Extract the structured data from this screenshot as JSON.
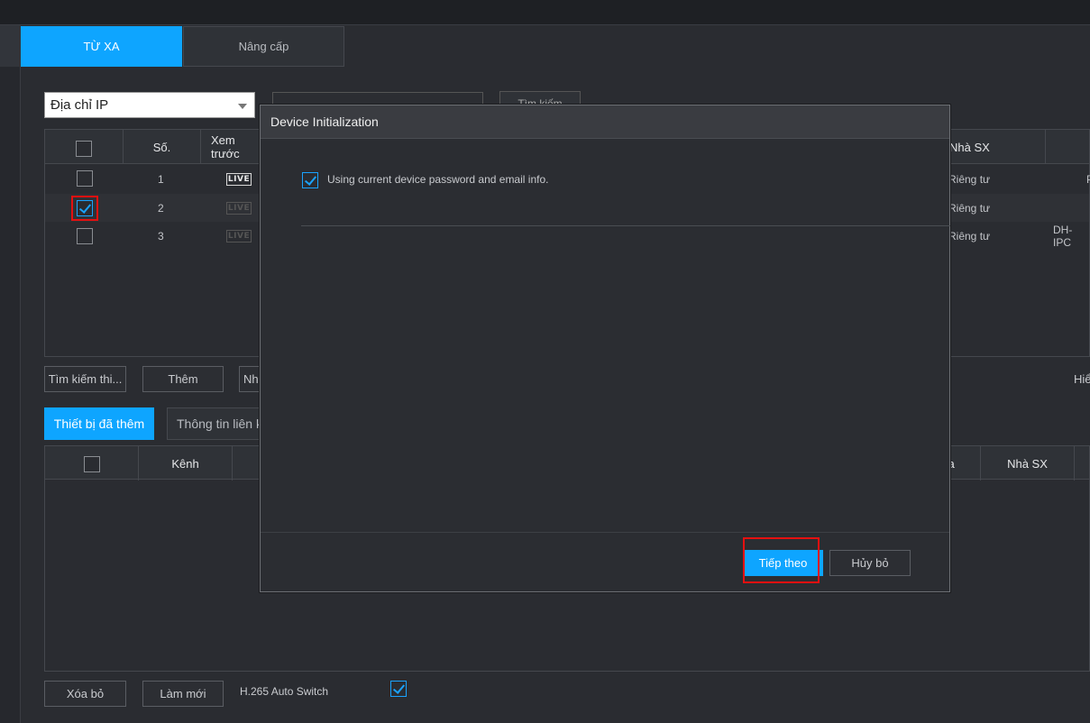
{
  "tabs": {
    "remote": "TỪ XA",
    "upgrade": "Nâng cấp"
  },
  "search": {
    "filter_selected": "Địa chỉ IP",
    "search_button": "Tìm kiếm"
  },
  "device_table": {
    "headers": {
      "no": "Số.",
      "preview": "Xem trước",
      "manufacturer": "Nhà SX"
    },
    "rows": [
      {
        "no": "1",
        "live": "LIVE",
        "manufacturer": "Riêng tư",
        "extra": "P"
      },
      {
        "no": "2",
        "live": "LIVE",
        "manufacturer": "Riêng tư",
        "extra": ""
      },
      {
        "no": "3",
        "live": "LIVE",
        "manufacturer": "Riêng tư",
        "extra": "DH-IPC"
      }
    ]
  },
  "actions": {
    "device_search": "Tìm kiếm thi...",
    "add": "Thêm",
    "import": "Nhập",
    "show": "Hiển"
  },
  "subtabs": {
    "added_devices": "Thiết bị đã thêm",
    "link_info": "Thông tin liên kết"
  },
  "added_table": {
    "headers": {
      "channel": "Kênh",
      "remote": "xa",
      "manufacturer": "Nhà SX"
    }
  },
  "bottom": {
    "delete": "Xóa bỏ",
    "refresh": "Làm mới",
    "h265_label": "H.265 Auto Switch"
  },
  "dialog": {
    "title": "Device Initialization",
    "option_label": "Using current device password and email info.",
    "next_button": "Tiếp theo",
    "cancel_button": "Hủy bỏ"
  },
  "colors": {
    "accent": "#0ea5ff",
    "highlight": "#e51010"
  }
}
